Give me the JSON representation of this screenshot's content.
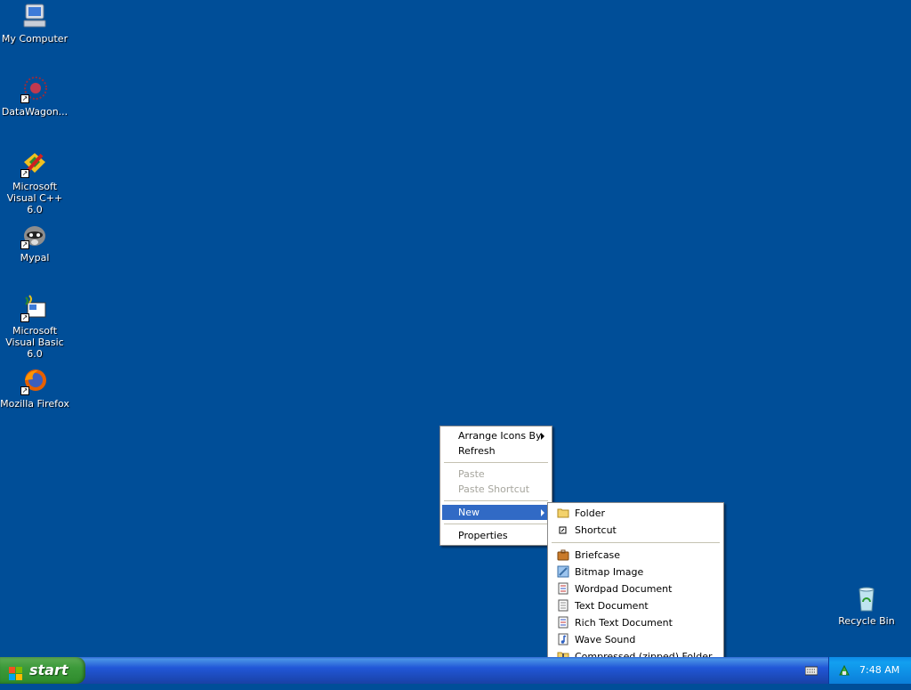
{
  "desktop_icons": [
    {
      "label": "My Computer",
      "icon": "my-computer-icon"
    },
    {
      "label": "DataWagon...",
      "icon": "datawagon-icon"
    },
    {
      "label": "Microsoft Visual C++ 6.0",
      "icon": "visual-cpp-icon"
    },
    {
      "label": "Mypal",
      "icon": "mypal-raccoon-icon"
    },
    {
      "label": "Microsoft Visual Basic 6.0",
      "icon": "visual-basic-icon"
    },
    {
      "label": "Mozilla Firefox",
      "icon": "firefox-icon"
    },
    {
      "label": "Recycle Bin",
      "icon": "recycle-bin-icon"
    }
  ],
  "context_menu": {
    "arrange": "Arrange Icons By",
    "refresh": "Refresh",
    "paste": "Paste",
    "paste_shortcut": "Paste Shortcut",
    "new": "New",
    "properties": "Properties"
  },
  "new_submenu": {
    "folder": "Folder",
    "shortcut": "Shortcut",
    "briefcase": "Briefcase",
    "bitmap": "Bitmap Image",
    "wordpad": "Wordpad Document",
    "text": "Text Document",
    "rtf": "Rich Text Document",
    "wave": "Wave Sound",
    "zip": "Compressed (zipped) Folder"
  },
  "taskbar": {
    "start_label": "start",
    "clock": "7:48 AM"
  },
  "colors": {
    "desktop": "#004E98",
    "highlight": "#316AC5"
  }
}
